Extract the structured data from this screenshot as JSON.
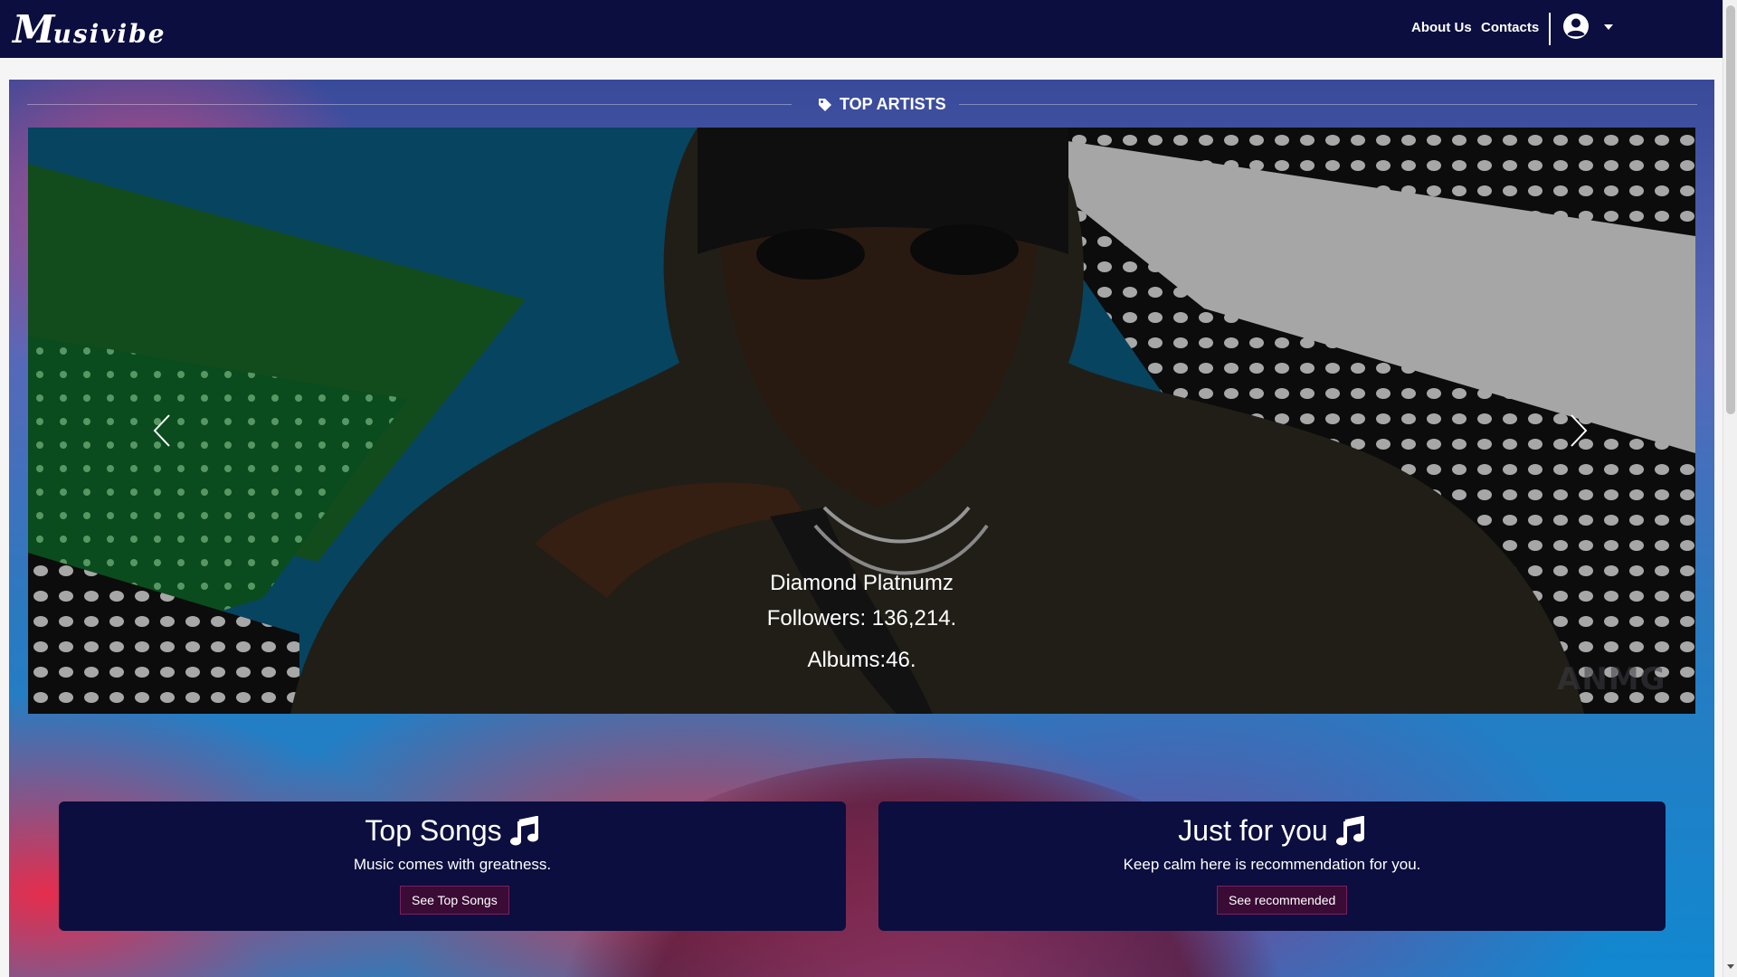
{
  "navbar": {
    "logo_initial": "M",
    "logo_rest": "usivibe",
    "links": [
      "About Us",
      "Contacts"
    ]
  },
  "section": {
    "title": "TOP ARTISTS"
  },
  "carousel": {
    "artist_name": "Diamond Platnumz",
    "followers": "Followers: 136,214.",
    "albums": "Albums:46.",
    "watermark": "ANMG"
  },
  "cards": [
    {
      "title": "Top Songs",
      "text": "Music comes with greatness.",
      "button": "See Top Songs"
    },
    {
      "title": "Just for you",
      "text": "Keep calm here is recommendation for you.",
      "button": "See recommended"
    }
  ],
  "colors": {
    "navbar_bg": "#0b0e3e",
    "card_bg": "#0b0e3e",
    "button_bg": "#3a0b35"
  }
}
